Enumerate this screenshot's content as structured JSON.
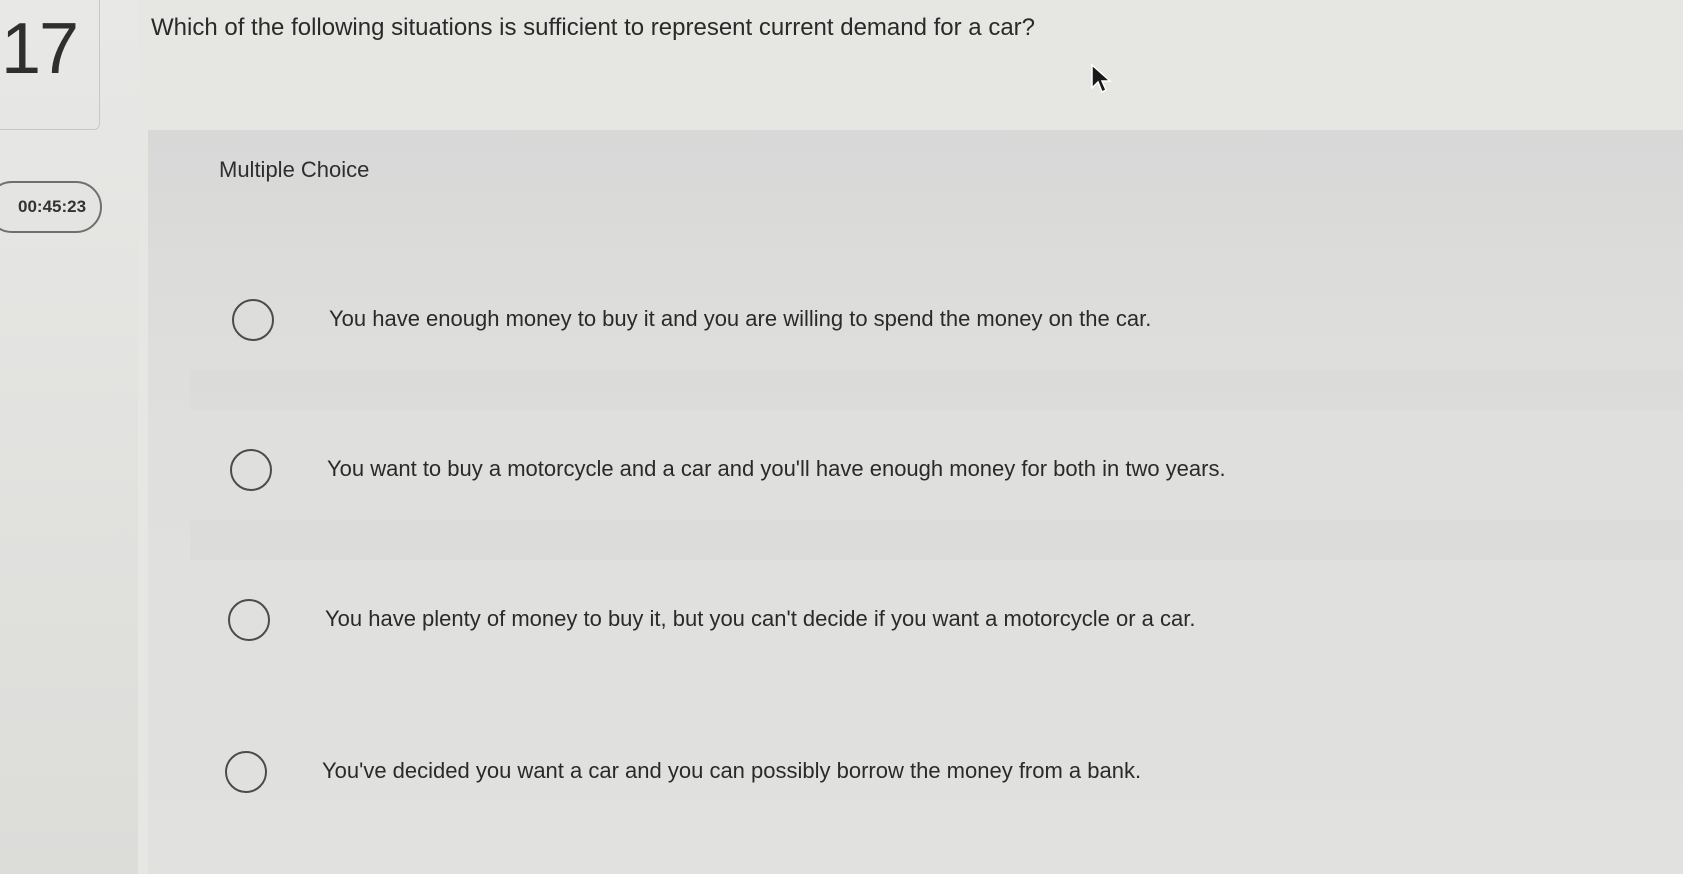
{
  "question": {
    "number": "17",
    "text": "Which of the following situations is sufficient to represent current demand for a car?"
  },
  "timer": {
    "value": "00:45:23"
  },
  "choices": {
    "type_label": "Multiple Choice",
    "options": [
      {
        "label": "You have enough money to buy it and you are willing to spend the money on the car."
      },
      {
        "label": "You want to buy a motorcycle and a car and you'll have enough money for both in two years."
      },
      {
        "label": "You have plenty of money to buy it, but you can't decide if you want a motorcycle or a car."
      },
      {
        "label": "You've decided you want a car and you can possibly borrow the money from a bank."
      }
    ]
  },
  "icons": {
    "cursor": "mouse-pointer-icon",
    "radio": "radio-button-icon"
  }
}
